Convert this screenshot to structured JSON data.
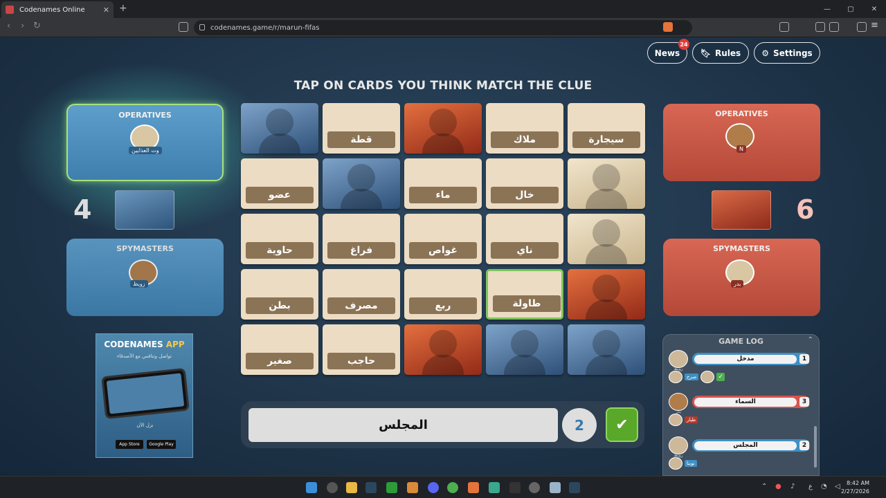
{
  "browser": {
    "tab_title": "Codenames Online",
    "tab_close": "✕",
    "new_tab": "+",
    "url": "codenames.game/r/marun-fifas",
    "window_controls": [
      "—",
      "▢",
      "✕"
    ]
  },
  "header": {
    "news_label": "News",
    "news_count": "24",
    "rules_label": "Rules",
    "settings_label": "Settings",
    "instruction": "TAP ON CARDS YOU THINK MATCH THE CLUE"
  },
  "blue_team": {
    "score": "4",
    "operatives_title": "OPERATIVES",
    "operative_name": "وت العذايين",
    "spymasters_title": "SPYMASTERS",
    "spymaster_name": "زويظ",
    "color": "#4a8dbf"
  },
  "red_team": {
    "score": "6",
    "operatives_title": "OPERATIVES",
    "operative_name": "N",
    "spymasters_title": "SPYMASTERS",
    "spymaster_name": "بدر",
    "color": "#c95444"
  },
  "board": {
    "cards": [
      {
        "word": "",
        "type": "agent-blue"
      },
      {
        "word": "قطة",
        "type": "word"
      },
      {
        "word": "",
        "type": "agent-red"
      },
      {
        "word": "ملاك",
        "type": "word"
      },
      {
        "word": "سيجارة",
        "type": "word"
      },
      {
        "word": "عضو",
        "type": "word"
      },
      {
        "word": "",
        "type": "agent-blue"
      },
      {
        "word": "ماء",
        "type": "word"
      },
      {
        "word": "خال",
        "type": "word"
      },
      {
        "word": "",
        "type": "bystander"
      },
      {
        "word": "حاوية",
        "type": "word"
      },
      {
        "word": "فراغ",
        "type": "word"
      },
      {
        "word": "غواص",
        "type": "word"
      },
      {
        "word": "ناي",
        "type": "word"
      },
      {
        "word": "",
        "type": "bystander"
      },
      {
        "word": "بطن",
        "type": "word"
      },
      {
        "word": "مصرف",
        "type": "word"
      },
      {
        "word": "ربع",
        "type": "word"
      },
      {
        "word": "طاولة",
        "type": "word-selected"
      },
      {
        "word": "",
        "type": "agent-red"
      },
      {
        "word": "صغير",
        "type": "word"
      },
      {
        "word": "حاجب",
        "type": "word"
      },
      {
        "word": "",
        "type": "agent-red"
      },
      {
        "word": "",
        "type": "agent-blue"
      },
      {
        "word": "",
        "type": "agent-blue"
      }
    ]
  },
  "clue": {
    "word": "المجلس",
    "number": "2",
    "confirm_icon": "✔"
  },
  "promo": {
    "title_a": "CODENAMES ",
    "title_b": "APP",
    "subtitle": "تواصل وتنافس مع الأصدقاء",
    "download": "نزل الآن",
    "app_store": "App Store",
    "google_play": "Google Play"
  },
  "game_log": {
    "title": "GAME LOG",
    "chevron": "⌃",
    "entries": [
      {
        "clue": "مدخل",
        "number": "1",
        "team": "blue",
        "giver": "زويظ",
        "guesser": "صرح"
      },
      {
        "clue": "السماء",
        "number": "3",
        "team": "red",
        "giver": "بدر",
        "guesser": "طيار"
      },
      {
        "clue": "المجلس",
        "number": "2",
        "team": "blue",
        "giver": "زويظ",
        "guesser": "نوبنا"
      }
    ]
  },
  "taskbar": {
    "time": "8:42 AM",
    "date": "2/27/2026",
    "lang": "ع"
  }
}
